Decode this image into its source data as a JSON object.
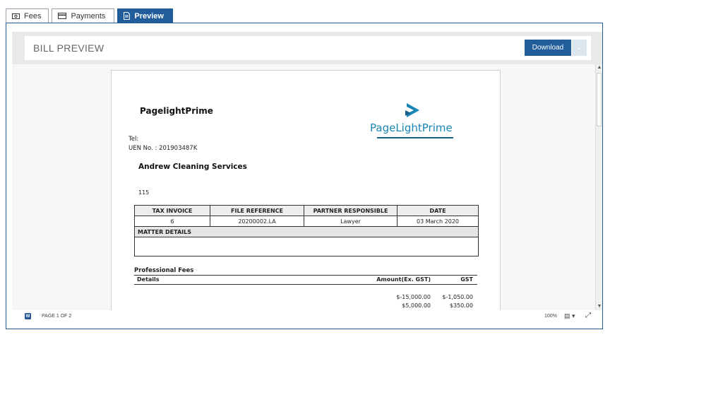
{
  "tabs": [
    {
      "label": "Fees",
      "icon": "money-icon",
      "active": false
    },
    {
      "label": "Payments",
      "icon": "card-icon",
      "active": false
    },
    {
      "label": "Preview",
      "icon": "document-icon",
      "active": true
    }
  ],
  "toolbar": {
    "title": "BILL PREVIEW",
    "download_label": "Download",
    "caret": "⌄"
  },
  "document": {
    "company": "PagelightPrime",
    "logo_text": "PageLightPrime",
    "tel": "Tel:",
    "uen": "UEN No. : 201903487K",
    "client": "Andrew Cleaning Services",
    "address_number": "115",
    "invoice_table": {
      "headers": [
        "TAX INVOICE",
        "FILE REFERENCE",
        "PARTNER RESPONSIBLE",
        "DATE"
      ],
      "row": [
        "6",
        "20200002.LA",
        "Lawyer",
        "03 March 2020"
      ],
      "matter_label": "MATTER DETAILS"
    },
    "professional_fees": {
      "title": "Professional Fees",
      "col_details": "Details",
      "col_amount": "Amount(Ex. GST)",
      "col_gst": "GST",
      "rows": [
        {
          "amount": "$-15,000.00",
          "gst": "$-1,050.00"
        },
        {
          "amount": "$5,000.00",
          "gst": "$350.00"
        }
      ]
    }
  },
  "status": {
    "page": "PAGE 1 OF 2",
    "zoom": "100%",
    "view_icon": "page-view-icon",
    "fit_icon": "fit-screen-icon"
  },
  "colors": {
    "accent": "#205d9a",
    "logo": "#1a86b5"
  }
}
